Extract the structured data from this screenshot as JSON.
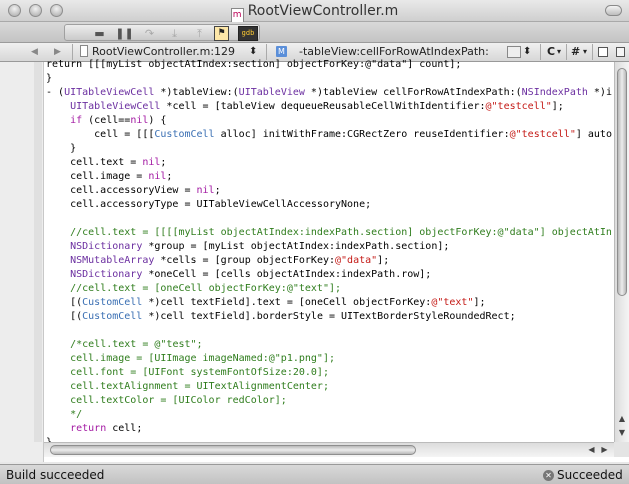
{
  "window": {
    "title": "RootViewController.m"
  },
  "toolbar": {
    "icons": [
      "breakpoint-toggle-icon",
      "pause-icon",
      "step-over-icon",
      "step-into-icon",
      "step-out-icon",
      "breakpoint-icon",
      "gdb-icon"
    ],
    "gdb_label": "gdb"
  },
  "navbar": {
    "back": "◀",
    "forward": "▶",
    "file_label": "RootViewController.m:129",
    "file_popup": "⬍",
    "method_badge": "M",
    "method_label": "-tableView:cellForRowAtIndexPath:",
    "method_popup": "⬍",
    "c_label": "C",
    "hash_label": "#"
  },
  "code": {
    "lines": [
      [
        [
          "t",
          "return [[[myList objectAtIndex:section] objectForKey:@\"data\"] count];"
        ]
      ],
      [
        [
          "t",
          "}"
        ]
      ],
      [
        [
          "t",
          "- ("
        ],
        [
          "ty",
          "UITableViewCell"
        ],
        [
          "t",
          " *)tableView:("
        ],
        [
          "ty",
          "UITableView"
        ],
        [
          "t",
          " *)tableView cellForRowAtIndexPath:("
        ],
        [
          "ty",
          "NSIndexPath"
        ],
        [
          "t",
          " *)i"
        ]
      ],
      [
        [
          "t",
          "    "
        ],
        [
          "ty",
          "UITableViewCell"
        ],
        [
          "t",
          " *cell = [tableView dequeueReusableCellWithIdentifier:"
        ],
        [
          "str",
          "@\"testcell\""
        ],
        [
          "t",
          "];"
        ]
      ],
      [
        [
          "t",
          "    "
        ],
        [
          "kw",
          "if"
        ],
        [
          "t",
          " (cell=="
        ],
        [
          "kw",
          "nil"
        ],
        [
          "t",
          ") {"
        ]
      ],
      [
        [
          "t",
          "        cell = [[["
        ],
        [
          "ob",
          "CustomCell"
        ],
        [
          "t",
          " alloc] initWithFrame:CGRectZero reuseIdentifier:"
        ],
        [
          "str",
          "@\"testcell\""
        ],
        [
          "t",
          "] auto"
        ]
      ],
      [
        [
          "t",
          "    }"
        ]
      ],
      [
        [
          "t",
          "    cell.text = "
        ],
        [
          "kw",
          "nil"
        ],
        [
          "t",
          ";"
        ]
      ],
      [
        [
          "t",
          "    cell.image = "
        ],
        [
          "kw",
          "nil"
        ],
        [
          "t",
          ";"
        ]
      ],
      [
        [
          "t",
          "    cell.accessoryView = "
        ],
        [
          "kw",
          "nil"
        ],
        [
          "t",
          ";"
        ]
      ],
      [
        [
          "t",
          "    cell.accessoryType = UITableViewCellAccessoryNone;"
        ]
      ],
      [
        [
          "t",
          ""
        ]
      ],
      [
        [
          "t",
          "    "
        ],
        [
          "cm",
          "//cell.text = [[[[myList objectAtIndex:indexPath.section] objectForKey:@\"data\"] objectAtIn"
        ]
      ],
      [
        [
          "t",
          "    "
        ],
        [
          "ty",
          "NSDictionary"
        ],
        [
          "t",
          " *group = [myList objectAtIndex:indexPath.section];"
        ]
      ],
      [
        [
          "t",
          "    "
        ],
        [
          "ty",
          "NSMutableArray"
        ],
        [
          "t",
          " *cells = [group objectForKey:"
        ],
        [
          "str",
          "@\"data\""
        ],
        [
          "t",
          "];"
        ]
      ],
      [
        [
          "t",
          "    "
        ],
        [
          "ty",
          "NSDictionary"
        ],
        [
          "t",
          " *oneCell = [cells objectAtIndex:indexPath.row];"
        ]
      ],
      [
        [
          "t",
          "    "
        ],
        [
          "cm",
          "//cell.text = [oneCell objectForKey:@\"text\"];"
        ]
      ],
      [
        [
          "t",
          "    [("
        ],
        [
          "ob",
          "CustomCell"
        ],
        [
          "t",
          " *)cell textField].text = [oneCell objectForKey:"
        ],
        [
          "str",
          "@\"text\""
        ],
        [
          "t",
          "];"
        ]
      ],
      [
        [
          "t",
          "    [("
        ],
        [
          "ob",
          "CustomCell"
        ],
        [
          "t",
          " *)cell textField].borderStyle = UITextBorderStyleRoundedRect;"
        ]
      ],
      [
        [
          "t",
          ""
        ]
      ],
      [
        [
          "t",
          "    "
        ],
        [
          "cm",
          "/*cell.text = @\"test\";"
        ]
      ],
      [
        [
          "cm",
          "    cell.image = [UIImage imageNamed:@\"p1.png\"];"
        ]
      ],
      [
        [
          "cm",
          "    cell.font = [UIFont systemFontOfSize:20.0];"
        ]
      ],
      [
        [
          "cm",
          "    cell.textAlignment = UITextAlignmentCenter;"
        ]
      ],
      [
        [
          "cm",
          "    cell.textColor = [UIColor redColor];"
        ]
      ],
      [
        [
          "cm",
          "    */"
        ]
      ],
      [
        [
          "t",
          "    "
        ],
        [
          "kw",
          "return"
        ],
        [
          "t",
          " cell;"
        ]
      ],
      [
        [
          "t",
          "}"
        ]
      ]
    ]
  },
  "status": {
    "left": "Build succeeded",
    "right": "Succeeded"
  }
}
